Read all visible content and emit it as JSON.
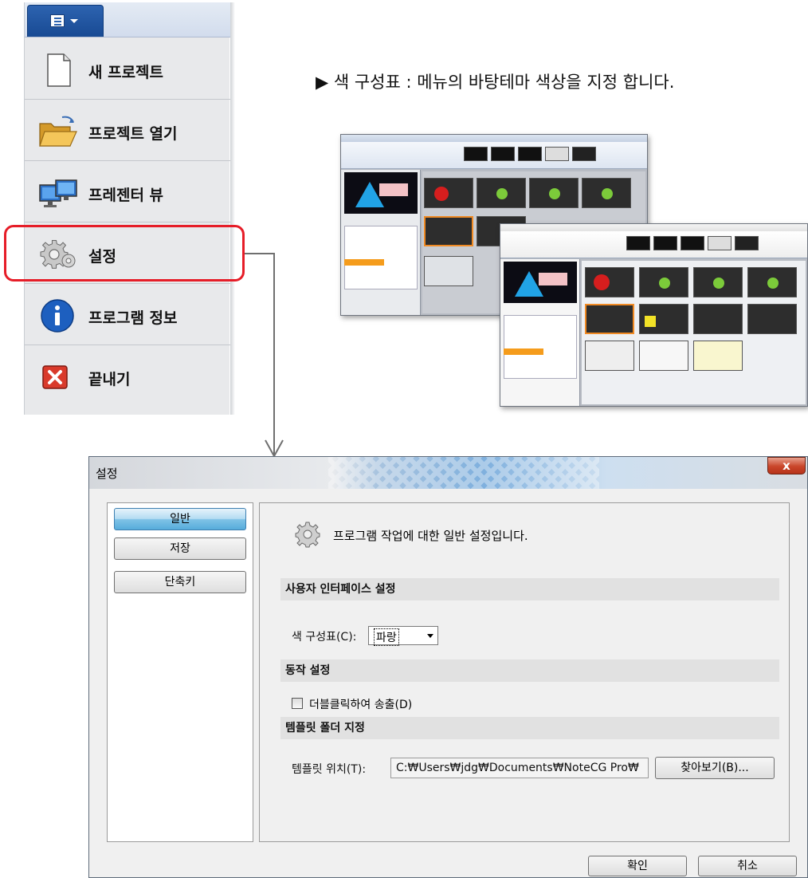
{
  "menu": {
    "items": [
      {
        "icon": "new-document-icon",
        "label": "새 프로젝트"
      },
      {
        "icon": "open-folder-icon",
        "label": "프로젝트 열기"
      },
      {
        "icon": "presenter-monitor-icon",
        "label": "프레젠터 뷰"
      },
      {
        "icon": "gear-icon",
        "label": "설정"
      },
      {
        "icon": "info-icon",
        "label": "프로그램 정보"
      },
      {
        "icon": "exit-icon",
        "label": "끝내기"
      }
    ],
    "highlighted_item": "설정",
    "highlight_color": "#e61d28"
  },
  "callout": {
    "text": "▶ 색 구성표 : 메뉴의 바탕테마 색상을 지정 합니다."
  },
  "dialog": {
    "title": "설정",
    "close_label": "x",
    "nav": [
      {
        "label": "일반",
        "selected": true
      },
      {
        "label": "저장",
        "selected": false
      },
      {
        "label": "단축키",
        "selected": false
      }
    ],
    "description": "프로그램 작업에 대한 일반 설정입니다.",
    "sections": {
      "ui": "사용자 인터페이스 설정",
      "action": "동작 설정",
      "template": "템플릿 폴더 지정"
    },
    "color_scheme": {
      "label": "색 구성표(C):",
      "value": "파랑"
    },
    "double_click": {
      "label": "더블클릭하여 송출(D)",
      "checked": false
    },
    "template_location": {
      "label": "템플릿 위치(T):",
      "value": "C:₩Users₩jdg₩Documents₩NoteCG Pro₩"
    },
    "browse_label": "찾아보기(B)...",
    "ok_label": "확인",
    "cancel_label": "취소"
  },
  "colors": {
    "menu_button": "#1f56a3",
    "selected_nav": "#7fc2e6",
    "close_button": "#c9452a"
  }
}
